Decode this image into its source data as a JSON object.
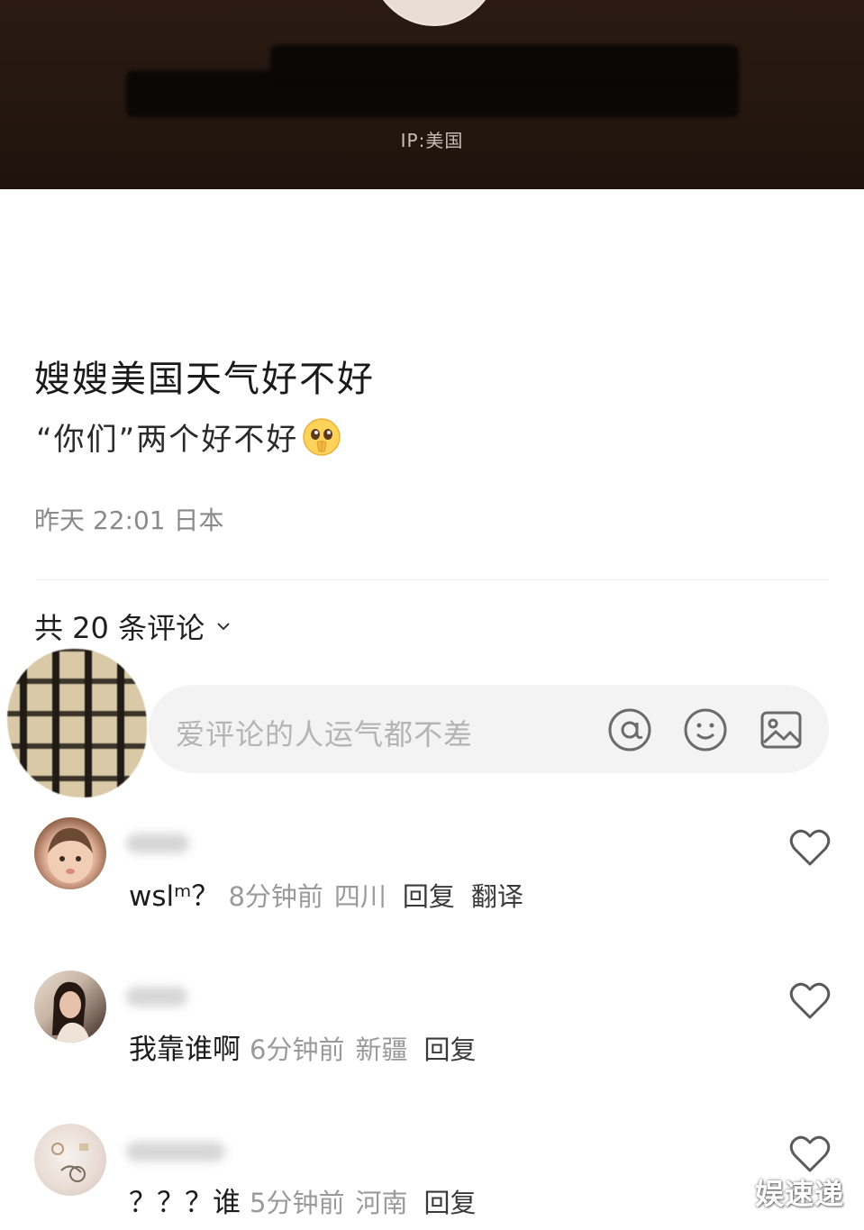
{
  "header": {
    "ip_label": "IP:美国"
  },
  "post": {
    "title": "嫂嫂美国天气好不好",
    "body": "“你们”两个好不好",
    "body_emoji": "pleading-face-emoji",
    "meta": "昨天 22:01 日本"
  },
  "comments_header": {
    "label": "共 20 条评论"
  },
  "comment_input": {
    "placeholder": "爱评论的人运气都不差",
    "icons": [
      "at-icon",
      "emoji-face-icon",
      "image-icon"
    ]
  },
  "comments": [
    {
      "text": "wslᵐ？",
      "time": "8分钟前",
      "location": "四川",
      "reply": "回复",
      "translate": "翻译"
    },
    {
      "text": "我靠谁啊",
      "time": "6分钟前",
      "location": "新疆",
      "reply": "回复"
    },
    {
      "text": "？？？谁",
      "time": "5分钟前",
      "location": "河南",
      "reply": "回复"
    }
  ],
  "watermark": "娱速递",
  "colors": {
    "header_bg": "#24170f",
    "text_primary": "#1c1c1c",
    "text_secondary": "#9a9a9a",
    "input_bg": "#f3f3f3"
  }
}
